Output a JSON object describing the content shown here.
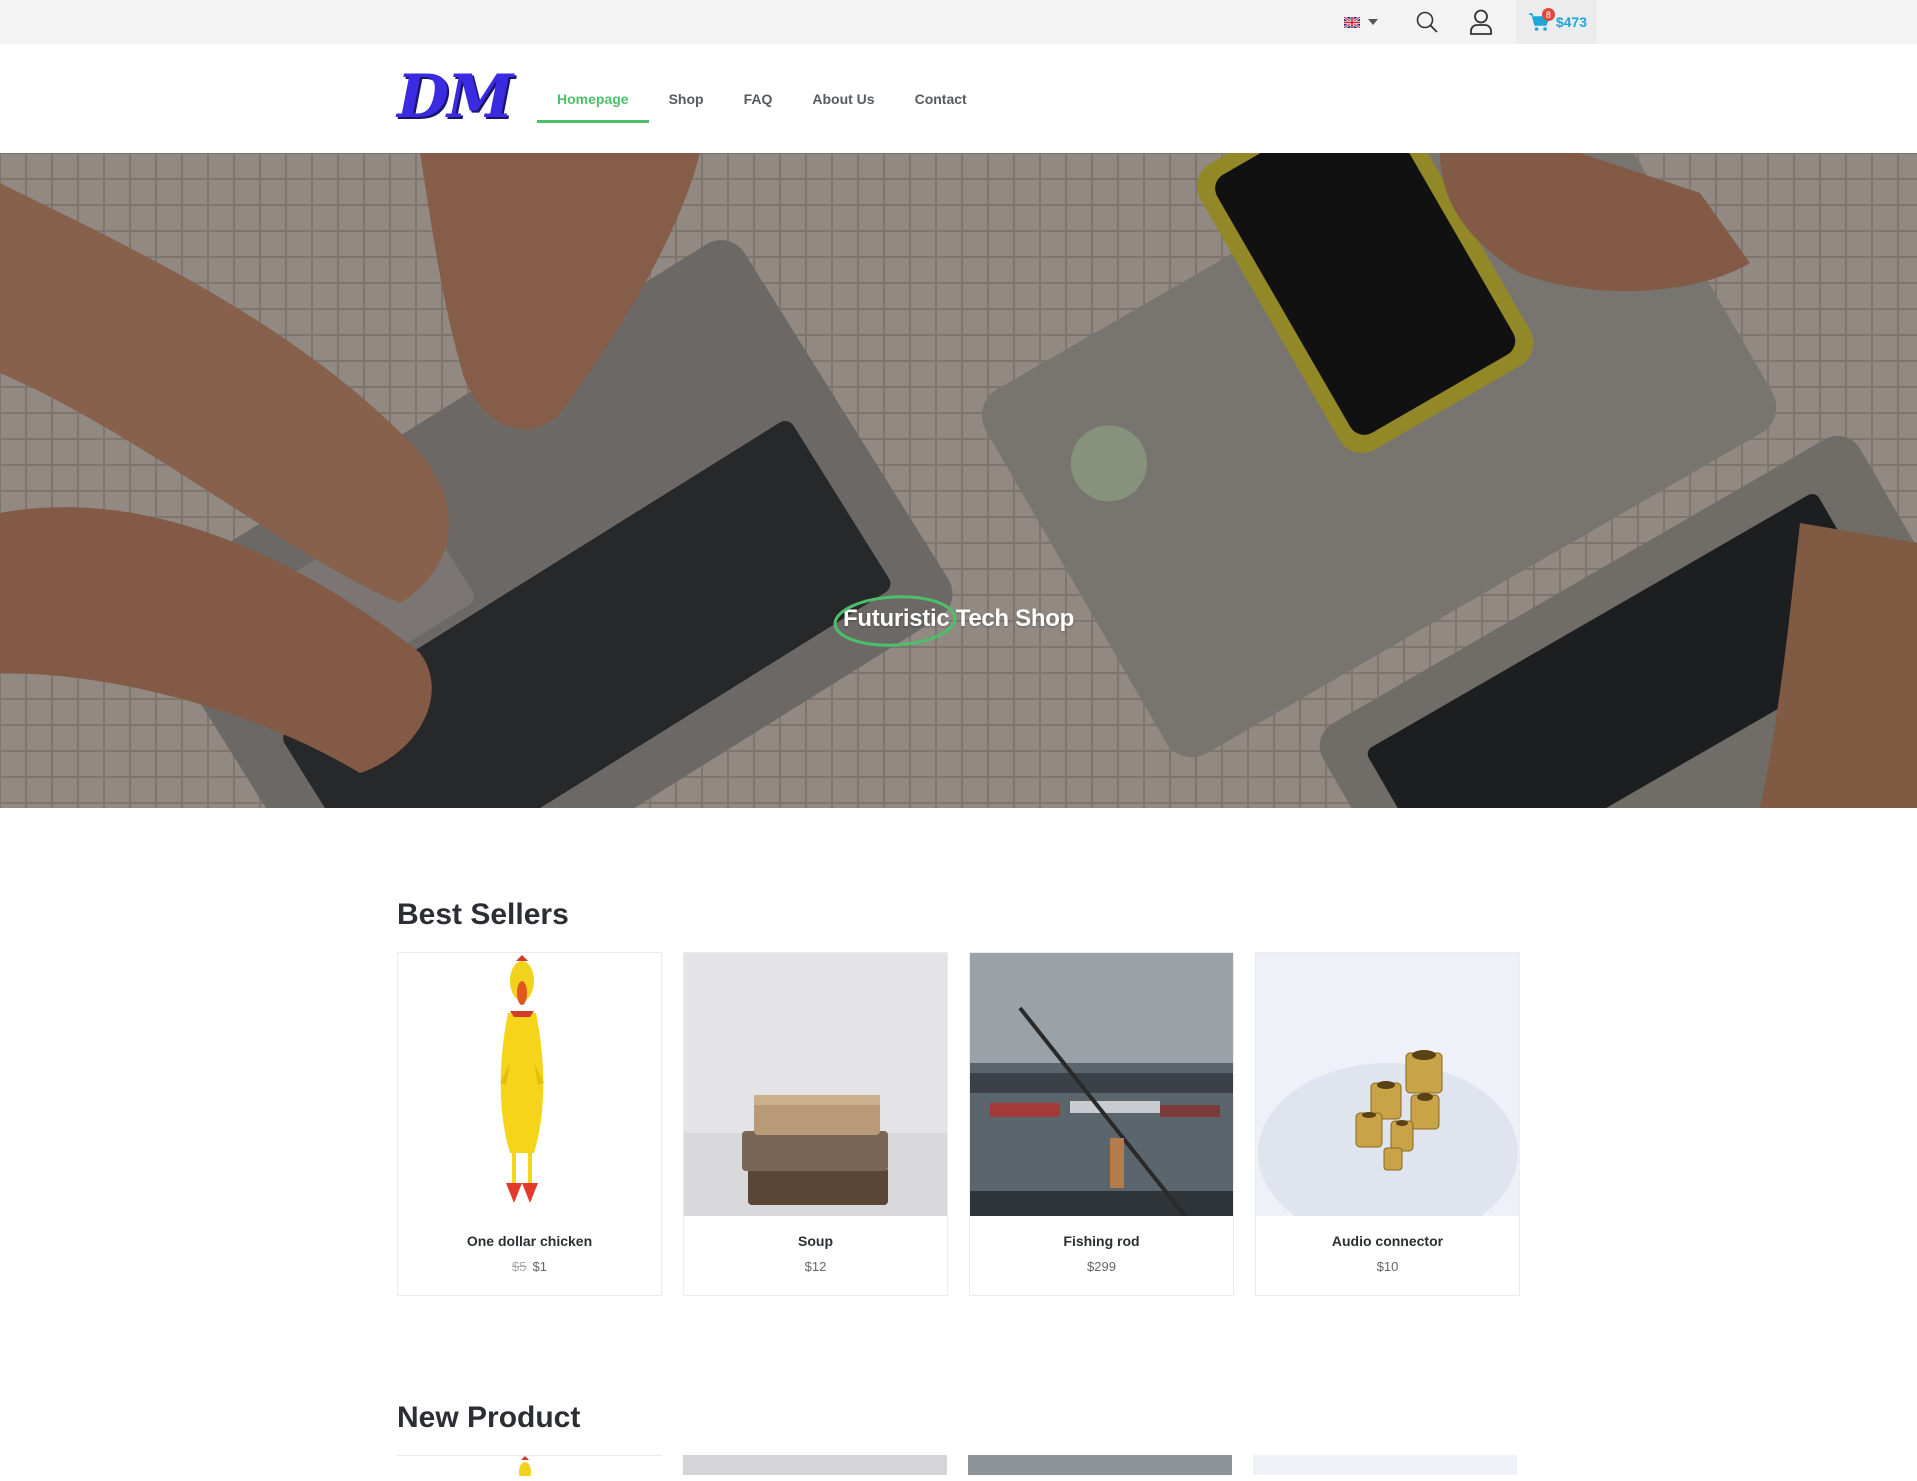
{
  "topbar": {
    "language_icon": "uk-flag-icon",
    "search_icon": "search-icon",
    "account_icon": "user-icon",
    "cart_icon": "cart-icon",
    "cart_count": "8",
    "cart_total": "$473"
  },
  "header": {
    "logo_text": "DM",
    "nav": [
      {
        "label": "Homepage",
        "active": true
      },
      {
        "label": "Shop"
      },
      {
        "label": "FAQ"
      },
      {
        "label": "About Us"
      },
      {
        "label": "Contact"
      }
    ]
  },
  "hero": {
    "title_highlight": "Futuristic",
    "title_rest": " Tech Shop"
  },
  "best_sellers": {
    "title": "Best Sellers",
    "products": [
      {
        "name": "One dollar chicken",
        "old_price": "$5",
        "price": "$1"
      },
      {
        "name": "Soup",
        "price": "$12"
      },
      {
        "name": "Fishing rod",
        "price": "$299"
      },
      {
        "name": "Audio connector",
        "price": "$10"
      }
    ]
  },
  "new_product": {
    "title": "New Product"
  },
  "colors": {
    "accent": "#4cbf6a",
    "cart": "#1da7d8",
    "logo": "#3b2be0"
  }
}
